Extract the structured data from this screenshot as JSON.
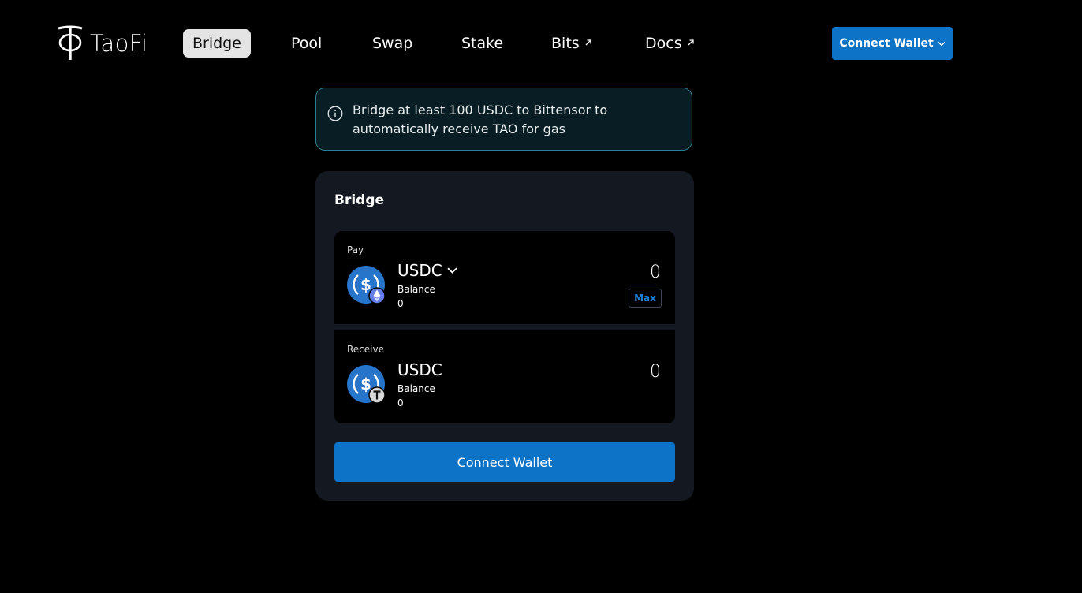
{
  "brand": {
    "logo_text": "TaoFi"
  },
  "nav": {
    "items": [
      {
        "label": "Bridge",
        "active": true,
        "external": false
      },
      {
        "label": "Pool",
        "active": false,
        "external": false
      },
      {
        "label": "Swap",
        "active": false,
        "external": false
      },
      {
        "label": "Stake",
        "active": false,
        "external": false
      },
      {
        "label": "Bits",
        "active": false,
        "external": true
      },
      {
        "label": "Docs",
        "active": false,
        "external": true
      }
    ]
  },
  "header": {
    "connect_label": "Connect Wallet"
  },
  "notice": {
    "text": "Bridge at least 100 USDC to Bittensor to automatically receive TAO for gas"
  },
  "bridge": {
    "title": "Bridge",
    "pay": {
      "label": "Pay",
      "token": "USDC",
      "network_badge": "ethereum-icon",
      "balance_label": "Balance",
      "balance_value": "0",
      "amount": "0",
      "max_label": "Max"
    },
    "receive": {
      "label": "Receive",
      "token": "USDC",
      "network_badge": "bittensor-icon",
      "balance_label": "Balance",
      "balance_value": "0",
      "amount": "0"
    },
    "connect_label": "Connect Wallet"
  },
  "colors": {
    "background": "#000000",
    "accent": "#0d73c7",
    "card": "#141820",
    "notice_border": "#2c7f90",
    "usdc": "#2775ca"
  }
}
